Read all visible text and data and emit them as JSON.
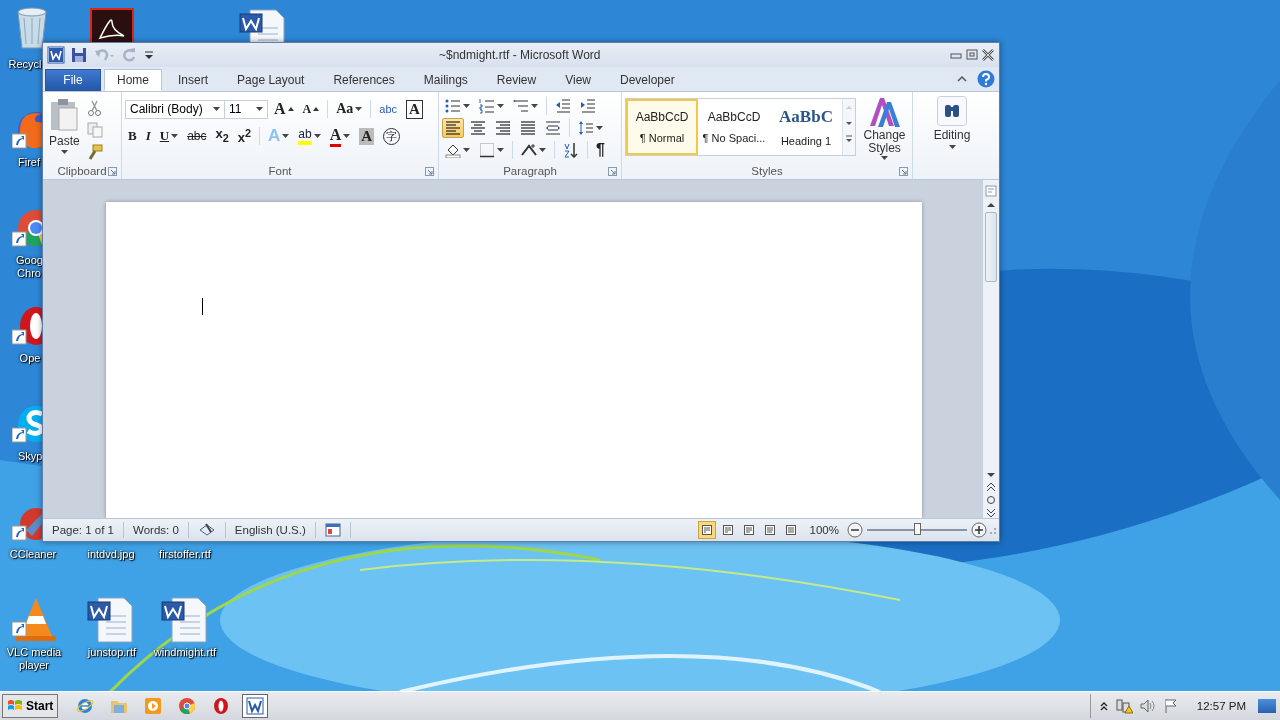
{
  "desktop_icons": [
    {
      "kind": "recycle",
      "label": "Recycl"
    },
    {
      "kind": "pdf"
    },
    {
      "kind": "word-doc"
    },
    {
      "kind": "firefox",
      "label": "Firef"
    },
    {
      "kind": "chrome",
      "label": "Goog Chro"
    },
    {
      "kind": "opera",
      "label": "Ope"
    },
    {
      "kind": "skype",
      "label": "Skyp"
    },
    {
      "kind": "ccleaner",
      "label": "CCleaner"
    },
    {
      "kind": "hidden",
      "label": "intdvd.jpg"
    },
    {
      "kind": "hidden",
      "label": "firstoffer.rtf"
    },
    {
      "kind": "vlc",
      "label": "VLC media player"
    },
    {
      "kind": "word-doc",
      "label": "junstop.rtf"
    },
    {
      "kind": "word-doc",
      "label": "windmight.rtf"
    }
  ],
  "window": {
    "title": "~$ndmight.rtf - Microsoft Word"
  },
  "tabs": [
    {
      "label": "File",
      "kind": "file",
      "selected": false
    },
    {
      "label": "Home",
      "kind": "tab",
      "selected": true
    },
    {
      "label": "Insert",
      "kind": "tab",
      "selected": false
    },
    {
      "label": "Page Layout",
      "kind": "tab",
      "selected": false
    },
    {
      "label": "References",
      "kind": "tab",
      "selected": false
    },
    {
      "label": "Mailings",
      "kind": "tab",
      "selected": false
    },
    {
      "label": "Review",
      "kind": "tab",
      "selected": false
    },
    {
      "label": "View",
      "kind": "tab",
      "selected": false
    },
    {
      "label": "Developer",
      "kind": "tab",
      "selected": false
    }
  ],
  "clipboard": {
    "paste": "Paste",
    "label": "Clipboard"
  },
  "font": {
    "name": "Calibri (Body)",
    "size": "11",
    "label": "Font",
    "row1": [
      {
        "text": "A",
        "kind": "grow"
      },
      {
        "text": "A",
        "kind": "shrink"
      },
      {
        "text": "Aa",
        "kind": "case"
      },
      {
        "text": "abc",
        "kind": "phonetic"
      },
      {
        "text": "A",
        "kind": "border"
      }
    ],
    "row2": [
      {
        "text": "B",
        "kind": "bold"
      },
      {
        "text": "I",
        "kind": "italic"
      },
      {
        "text": "U",
        "kind": "underline"
      },
      {
        "text": "abc",
        "kind": "strike"
      },
      {
        "text": "x$_{2}$",
        "kind": "plain"
      },
      {
        "text": "x$^{2}$",
        "kind": "plain"
      },
      {
        "text": "A",
        "kind": "effect"
      },
      {
        "text": "ab",
        "kind": "highlight"
      },
      {
        "text": "A",
        "kind": "color"
      },
      {
        "text": "A",
        "kind": "shade"
      },
      {
        "text": "字",
        "kind": "enclose"
      }
    ]
  },
  "paragraph": {
    "label": "Paragraph",
    "pilcrow": "¶",
    "align": [
      {
        "selected": true
      },
      {
        "selected": false
      },
      {
        "selected": false
      },
      {
        "selected": false
      }
    ]
  },
  "styles": {
    "label": "Styles",
    "change_styles": "Change Styles",
    "items": [
      {
        "preview": "AaBbCcD",
        "name": "¶ Normal",
        "kind": "body",
        "selected": true
      },
      {
        "preview": "AaBbCcD",
        "name": "¶ No Spaci...",
        "kind": "body",
        "selected": false
      },
      {
        "preview": "AaBbC",
        "name": "Heading 1",
        "kind": "heading",
        "selected": false
      }
    ]
  },
  "editing": {
    "label": "Editing"
  },
  "status_bar": {
    "page": "Page: 1 of 1",
    "words": "Words: 0",
    "language": "English (U.S.)",
    "views": [
      {
        "selected": true
      },
      {
        "selected": false
      },
      {
        "selected": false
      },
      {
        "selected": false
      },
      {
        "selected": false
      }
    ],
    "zoom": "100%",
    "zoom_slider": {
      "level": 0.5
    }
  },
  "taskbar": {
    "start": "Start",
    "apps": [
      {
        "kind": "ie",
        "selected": false
      },
      {
        "kind": "folder",
        "selected": false
      },
      {
        "kind": "media",
        "selected": false
      },
      {
        "kind": "chrome",
        "selected": false
      },
      {
        "kind": "opera",
        "selected": false
      },
      {
        "kind": "word",
        "selected": true
      }
    ],
    "clock": "12:57 PM"
  }
}
